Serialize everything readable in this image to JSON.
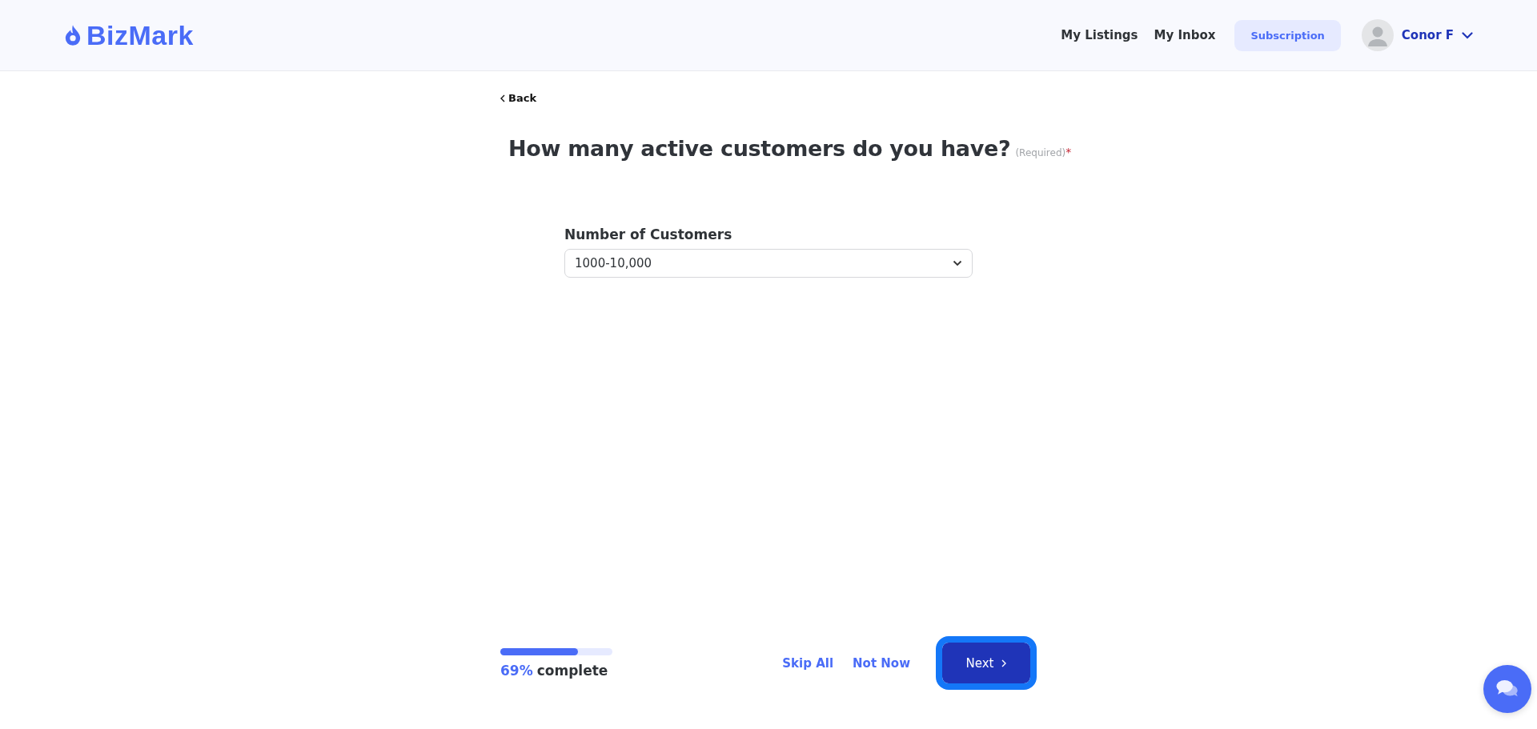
{
  "header": {
    "logo": "BizMark",
    "nav": [
      "My Listings",
      "My Inbox"
    ],
    "subscription": "Subscription",
    "user": {
      "name": "Conor F"
    }
  },
  "back": "Back",
  "question": {
    "text": "How many active customers do you have?",
    "note": "(Required)",
    "mark": "*"
  },
  "field": {
    "label": "Number of Customers",
    "value": "1000-10,000"
  },
  "progress": {
    "level": 0.69,
    "percent": "69%",
    "label": "complete"
  },
  "actions": {
    "skip_all": "Skip All",
    "not_now": "Not Now",
    "next": {
      "label": "Next",
      "focused": true
    }
  }
}
